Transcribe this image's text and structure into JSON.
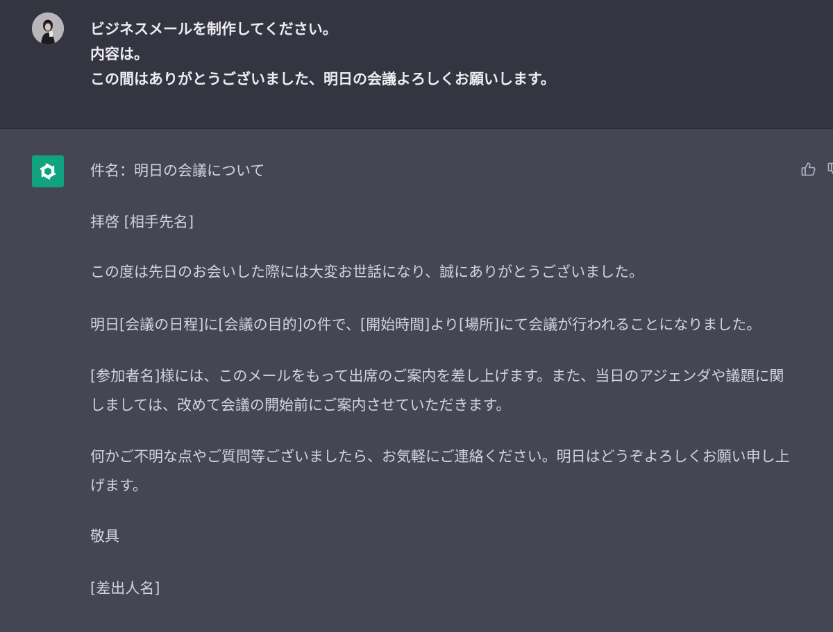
{
  "user_message": {
    "lines": [
      "ビジネスメールを制作してください。",
      "内容は。",
      "この間はありがとうございました、明日の会議よろしくお願いします。"
    ]
  },
  "assistant_message": {
    "paragraphs": [
      "件名：明日の会議について",
      "拝啓 [相手先名]",
      "この度は先日のお会いした際には大変お世話になり、誠にありがとうございました。",
      "明日[会議の日程]に[会議の目的]の件で、[開始時間]より[場所]にて会議が行われることになりました。",
      "[参加者名]様には、このメールをもって出席のご案内を差し上げます。また、当日のアジェンダや議題に関しましては、改めて会議の開始前にご案内させていただきます。",
      "何かご不明な点やご質問等ございましたら、お気軽にご連絡ください。明日はどうぞよろしくお願い申し上げます。",
      "敬具",
      "[差出人名]"
    ]
  },
  "icons": {
    "user_avatar": "user-avatar",
    "assistant_avatar": "openai-logo-icon",
    "thumbs_up": "thumbs-up-icon",
    "thumbs_down": "thumbs-down-icon"
  },
  "colors": {
    "user_bg": "#343541",
    "assistant_bg": "#444654",
    "assistant_avatar_bg": "#10a37f",
    "text": "#ececf1"
  }
}
